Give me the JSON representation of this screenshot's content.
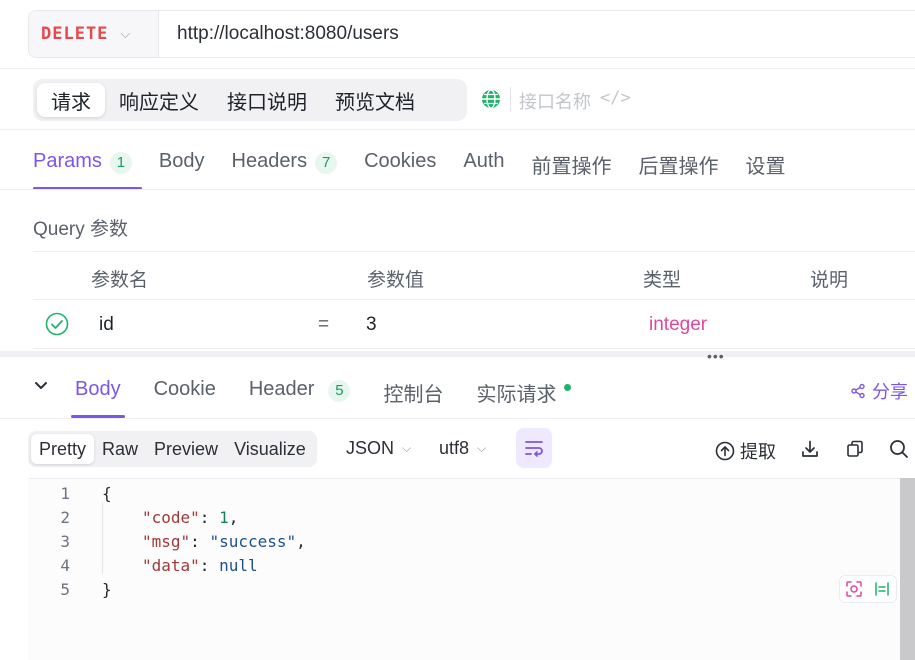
{
  "request": {
    "method": "DELETE",
    "url": "http://localhost:8080/users"
  },
  "segment_tabs": [
    {
      "label": "请求",
      "active": true
    },
    {
      "label": "响应定义",
      "active": false
    },
    {
      "label": "接口说明",
      "active": false
    },
    {
      "label": "预览文档",
      "active": false
    }
  ],
  "api_name_placeholder": "接口名称",
  "code_tag": "</>",
  "request_tabs": [
    {
      "label": "Params",
      "badge": "1",
      "active": true
    },
    {
      "label": "Body",
      "badge": "",
      "active": false
    },
    {
      "label": "Headers",
      "badge": "7",
      "active": false
    },
    {
      "label": "Cookies",
      "badge": "",
      "active": false
    },
    {
      "label": "Auth",
      "badge": "",
      "active": false
    },
    {
      "label": "前置操作",
      "badge": "",
      "active": false
    },
    {
      "label": "后置操作",
      "badge": "",
      "active": false
    },
    {
      "label": "设置",
      "badge": "",
      "active": false
    }
  ],
  "query": {
    "title": "Query 参数",
    "columns": [
      "参数名",
      "参数值",
      "类型",
      "说明"
    ],
    "rows": [
      {
        "enabled": true,
        "name": "id",
        "eq": "=",
        "value": "3",
        "type": "integer",
        "desc": ""
      }
    ]
  },
  "splitter_handle": "•••",
  "response_tabs": [
    {
      "label": "Body",
      "badge": "",
      "active": true
    },
    {
      "label": "Cookie",
      "badge": "",
      "active": false
    },
    {
      "label": "Header",
      "badge": "5",
      "active": false
    },
    {
      "label": "控制台",
      "badge": "",
      "active": false
    },
    {
      "label": "实际请求",
      "badge": "",
      "dot": true,
      "active": false
    }
  ],
  "share_label": "分享",
  "format_tabs": [
    {
      "label": "Pretty",
      "active": true
    },
    {
      "label": "Raw",
      "active": false
    },
    {
      "label": "Preview",
      "active": false
    },
    {
      "label": "Visualize",
      "active": false
    }
  ],
  "response_format": "JSON",
  "encoding": "utf8",
  "extract_label": "提取",
  "code_lines": [
    {
      "n": "1",
      "text": "{"
    },
    {
      "n": "2",
      "key": "\"code\"",
      "value": "1",
      "vtype": "num",
      "comma": ","
    },
    {
      "n": "3",
      "key": "\"msg\"",
      "value": "\"success\"",
      "vtype": "str",
      "comma": ","
    },
    {
      "n": "4",
      "key": "\"data\"",
      "value": "null",
      "vtype": "nl",
      "comma": ""
    },
    {
      "n": "5",
      "text": "}"
    }
  ],
  "colors": {
    "accent": "#7c56e8",
    "method": "#e5484d",
    "type": "#e0479e",
    "success": "#1fb36b"
  }
}
